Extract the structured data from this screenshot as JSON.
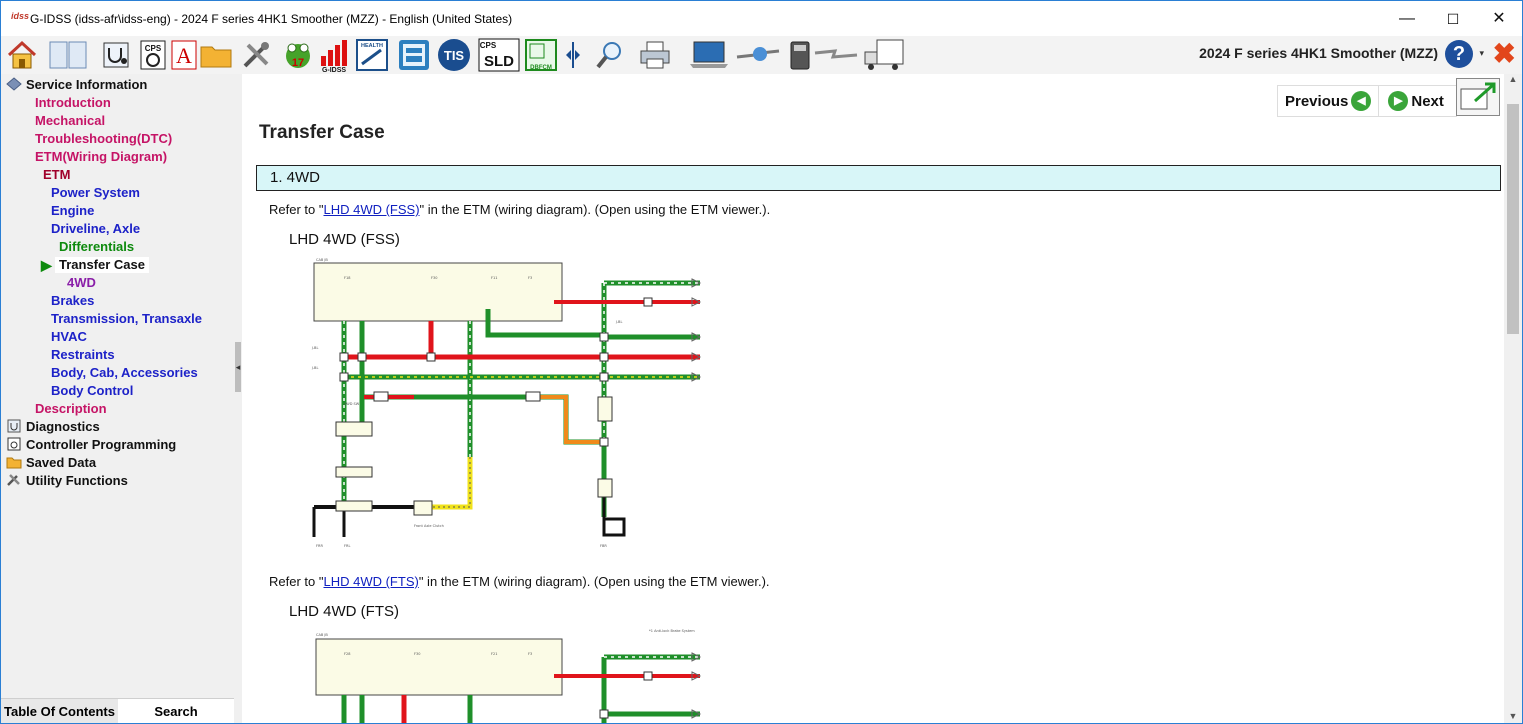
{
  "window": {
    "app_icon": "idss",
    "title": "G-IDSS (idss-afr\\idss-eng) - 2024 F series 4HK1 Smoother (MZZ) - English (United States)",
    "minimize_glyph": "—",
    "maximize_glyph": "☐",
    "close_glyph": "✕"
  },
  "toolbar": {
    "vehicle_title": "2024 F series 4HK1 Smoother (MZZ)",
    "help_glyph": "?",
    "help_caret": "▾",
    "close_glyph": "✖",
    "buttons": [
      {
        "name": "home-icon"
      },
      {
        "name": "book-icon"
      },
      {
        "name": "stethoscope-icon"
      },
      {
        "name": "cps-icon",
        "label": "CPS"
      },
      {
        "name": "font-a-icon",
        "label": "A"
      },
      {
        "name": "folder-icon"
      },
      {
        "name": "tools-icon"
      },
      {
        "name": "frog-icon",
        "label": "17"
      },
      {
        "name": "gidss-chart-icon",
        "label": "G-IDSS"
      },
      {
        "name": "health-report-icon",
        "label": "HEALTH"
      },
      {
        "name": "calculator-icon"
      },
      {
        "name": "tis-icon",
        "label": "TIS"
      },
      {
        "name": "cps-sld-icon",
        "label": "SLD",
        "label_top": "CPS"
      },
      {
        "name": "dbfcm-icon",
        "label": "DBFCM"
      },
      {
        "name": "split-icon"
      },
      {
        "name": "magnifier-icon"
      },
      {
        "name": "printer-icon"
      },
      {
        "name": "laptop-icon"
      },
      {
        "name": "network-icon"
      },
      {
        "name": "device-icon"
      },
      {
        "name": "lightning-icon"
      },
      {
        "name": "truck-icon"
      }
    ]
  },
  "sidebar": {
    "items": [
      {
        "label": "Service Information",
        "color": "black",
        "icon": "diamond-icon"
      },
      {
        "label": "Introduction",
        "color": "pink"
      },
      {
        "label": "Mechanical",
        "color": "pink"
      },
      {
        "label": "Troubleshooting(DTC)",
        "color": "pink"
      },
      {
        "label": "ETM(Wiring Diagram)",
        "color": "pink"
      },
      {
        "label": "ETM",
        "color": "darkred"
      },
      {
        "label": "Power System",
        "color": "blue"
      },
      {
        "label": "Engine",
        "color": "blue"
      },
      {
        "label": "Driveline, Axle",
        "color": "blue"
      },
      {
        "label": "Differentials",
        "color": "green"
      },
      {
        "label": "Transfer Case",
        "color": "black",
        "selected": true
      },
      {
        "label": "4WD",
        "color": "purple"
      },
      {
        "label": "Brakes",
        "color": "blue"
      },
      {
        "label": "Transmission, Transaxle",
        "color": "blue"
      },
      {
        "label": "HVAC",
        "color": "blue"
      },
      {
        "label": "Restraints",
        "color": "blue"
      },
      {
        "label": "Body, Cab, Accessories",
        "color": "blue"
      },
      {
        "label": "Body Control",
        "color": "blue"
      },
      {
        "label": "Description",
        "color": "pink"
      },
      {
        "label": "Diagnostics",
        "color": "black",
        "icon": "diagnostics-icon"
      },
      {
        "label": "Controller Programming",
        "color": "black",
        "icon": "controller-icon"
      },
      {
        "label": "Saved Data",
        "color": "black",
        "icon": "folder-icon"
      },
      {
        "label": "Utility Functions",
        "color": "black",
        "icon": "wrench-icon"
      }
    ],
    "selected_marker": "▶",
    "tabs": {
      "toc": "Table Of Contents",
      "search": "Search"
    },
    "collapse_glyph": "◂"
  },
  "content": {
    "nav": {
      "previous": "Previous",
      "next": "Next",
      "prev_glyph": "◀",
      "next_glyph": "▶"
    },
    "page_title": "Transfer Case",
    "section": "1. 4WD",
    "refs": [
      {
        "before": "Refer to \"",
        "link": "LHD 4WD (FSS)",
        "after": "\" in the ETM (wiring diagram). (Open using the ETM viewer.)."
      },
      {
        "before": "Refer to \"",
        "link": "LHD 4WD (FTS)",
        "after": "\" in the ETM (wiring diagram). (Open using the ETM viewer.)."
      }
    ],
    "diagrams": [
      {
        "title": "LHD 4WD (FSS)"
      },
      {
        "title": "LHD 4WD (FTS)"
      }
    ]
  },
  "scrollbar": {
    "up_glyph": "▲",
    "down_glyph": "▼"
  },
  "colors": {
    "pink": "#c51466",
    "blue": "#1d22c8",
    "green": "#0d8a0d",
    "darkred": "#a0002a",
    "purple": "#8a1fa8",
    "section_bg": "#d8f6f8",
    "wire_green": "#1f8f2a",
    "wire_red": "#e0141b",
    "wire_orange": "#f08a1a",
    "wire_yellow": "#f0e21a"
  }
}
